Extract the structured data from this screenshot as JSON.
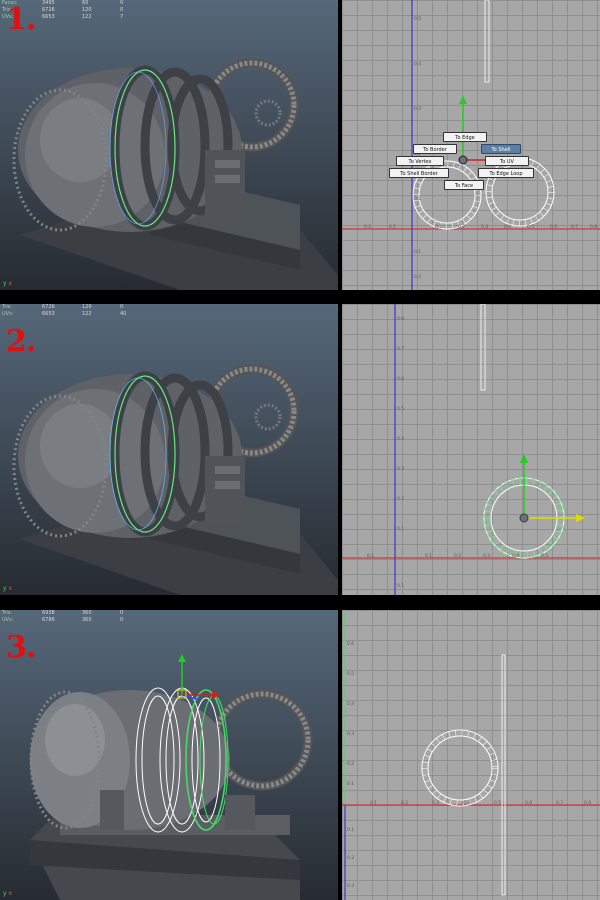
{
  "steps": [
    {
      "number": "1.",
      "stats": [
        {
          "label": "Faces:",
          "v1": "3495",
          "v2": "60",
          "v3": "0"
        },
        {
          "label": "Tris:",
          "v1": "6726",
          "v2": "120",
          "v3": "0"
        },
        {
          "label": "UVs:",
          "v1": "6653",
          "v2": "122",
          "v3": "7"
        }
      ],
      "uv_ticks_x": [
        "0.2",
        "0.1",
        "0.1",
        "0.2",
        "0.3",
        "0.4",
        "0.5",
        "0.6",
        "0.7",
        "0.8"
      ],
      "uv_ticks_y": [
        "0.5",
        "0.4",
        "0.3",
        "0.2",
        "0.1",
        "0.1",
        "0.2"
      ],
      "marking_menu": {
        "to_edge": "To Edge",
        "to_border": "To Border",
        "to_shell": "To Shell",
        "to_vertex": "To Vertex",
        "to_uv": "To UV",
        "to_shell_border": "To Shell Border",
        "to_edge_loop": "To Edge Loop",
        "to_face": "To Face",
        "active": "to_shell"
      }
    },
    {
      "number": "2.",
      "stats": [
        {
          "label": "Tris:",
          "v1": "6726",
          "v2": "120",
          "v3": "0"
        },
        {
          "label": "UVs:",
          "v1": "6653",
          "v2": "122",
          "v3": "40"
        }
      ],
      "uv_ticks_x": [
        "0.1",
        "0.1",
        "0.2",
        "0.3",
        "0.4",
        "0.5"
      ],
      "uv_ticks_y": [
        "0.8",
        "0.7",
        "0.6",
        "0.5",
        "0.4",
        "0.3",
        "0.2",
        "0.1",
        "0.1"
      ]
    },
    {
      "number": "3.",
      "stats": [
        {
          "label": "Tris:",
          "v1": "6938",
          "v2": "360",
          "v3": "0"
        },
        {
          "label": "UVs:",
          "v1": "6786",
          "v2": "360",
          "v3": "0"
        }
      ],
      "uv_ticks_x": [
        "0.1",
        "0.2",
        "0.3",
        "0.4",
        "0.5",
        "0.6",
        "0.7",
        "0.8"
      ],
      "uv_ticks_y": [
        "0.6",
        "0.5",
        "0.4",
        "0.3",
        "0.2",
        "0.1",
        "0.1",
        "0.2",
        "0.3"
      ]
    }
  ],
  "axis_labels": {
    "x": "x",
    "y": "y"
  },
  "colors": {
    "step_number": "#e01010",
    "selection_edges": "#66ff88",
    "uv_u_axis": "#d02020",
    "uv_v_axis": "#2020d0",
    "manip_y": "#22cc22",
    "manip_x": "#dddd00",
    "uv_shell": "#ffffff"
  }
}
